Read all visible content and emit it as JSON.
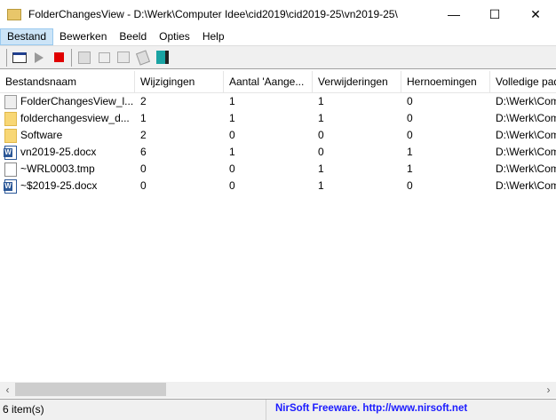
{
  "window": {
    "title": "FolderChangesView  -  D:\\Werk\\Computer Idee\\cid2019\\cid2019-25\\vn2019-25\\",
    "minimize": "—",
    "maximize": "☐",
    "close": "✕"
  },
  "menu": [
    "Bestand",
    "Bewerken",
    "Beeld",
    "Opties",
    "Help"
  ],
  "toolbar": [
    "properties-icon",
    "play-icon",
    "stop-icon",
    "save-icon",
    "copy-icon",
    "html-report-icon",
    "explorer-icon",
    "exit-icon"
  ],
  "columns": [
    "Bestandsnaam",
    "Wijzigingen",
    "Aantal 'Aange...",
    "Verwijderingen",
    "Hernoemingen",
    "Volledige pad"
  ],
  "rows": [
    {
      "icon": "exe",
      "name": "FolderChangesView_l...",
      "changes": "2",
      "added": "1",
      "deleted": "1",
      "renamed": "0",
      "path": "D:\\Werk\\Com"
    },
    {
      "icon": "folder",
      "name": "folderchangesview_d...",
      "changes": "1",
      "added": "1",
      "deleted": "1",
      "renamed": "0",
      "path": "D:\\Werk\\Com"
    },
    {
      "icon": "folder",
      "name": "Software",
      "changes": "2",
      "added": "0",
      "deleted": "0",
      "renamed": "0",
      "path": "D:\\Werk\\Com"
    },
    {
      "icon": "word",
      "name": "vn2019-25.docx",
      "changes": "6",
      "added": "1",
      "deleted": "0",
      "renamed": "1",
      "path": "D:\\Werk\\Com"
    },
    {
      "icon": "doc",
      "name": "~WRL0003.tmp",
      "changes": "0",
      "added": "0",
      "deleted": "1",
      "renamed": "1",
      "path": "D:\\Werk\\Com"
    },
    {
      "icon": "word",
      "name": "~$2019-25.docx",
      "changes": "0",
      "added": "0",
      "deleted": "1",
      "renamed": "0",
      "path": "D:\\Werk\\Com"
    }
  ],
  "status": {
    "count": "6 item(s)",
    "credit": "NirSoft Freeware.  http://www.nirsoft.net"
  }
}
